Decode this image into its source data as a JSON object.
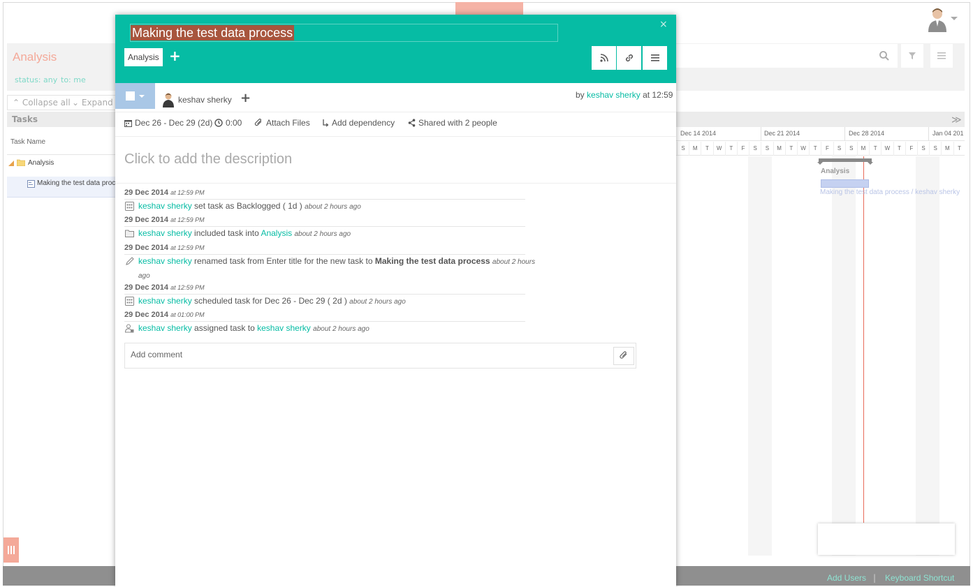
{
  "project": {
    "title": "Analysis",
    "filters": [
      "status: any",
      "to: me"
    ],
    "collapse_all": "Collapse all",
    "expand_all": "Expand a"
  },
  "task_panel": {
    "header": "Tasks",
    "column": "Task Name",
    "rows": [
      {
        "label": "Analysis",
        "icon": "folder-icon"
      },
      {
        "label": "Making the test data proce",
        "icon": "task-icon"
      }
    ]
  },
  "gantt": {
    "weeks": [
      "Dec 14 2014",
      "Dec 21 2014",
      "Dec 28 2014",
      "Jan 04 201"
    ],
    "days": [
      "S",
      "M",
      "T",
      "W",
      "T",
      "F",
      "S",
      "S",
      "M",
      "T",
      "W",
      "T",
      "F",
      "S",
      "S",
      "M",
      "T",
      "W",
      "T",
      "F",
      "S",
      "S",
      "M",
      "T"
    ],
    "group_label": "Analysis",
    "task_label": "Making the test data process / keshav sherky"
  },
  "footer": {
    "add_users": "Add Users",
    "separator": "|",
    "shortcut": "Keyboard Shortcut"
  },
  "modal": {
    "title": "Making the test data process",
    "close": "×",
    "tag": "Analysis",
    "add_tag": "+",
    "assignee": "keshav sherky",
    "add_assignee": "+",
    "created_prefix": "by",
    "created_by": "keshav sherky",
    "created_at": "at 12:59",
    "dates": "Dec 26 - Dec 29 (2d)",
    "time": "0:00",
    "attach": "Attach Files",
    "dependency": "Add dependency",
    "shared": "Shared with 2 people",
    "description_placeholder": "Click to add the description",
    "comment_placeholder": "Add comment",
    "log": [
      {
        "date": "29 Dec 2014",
        "time": "at 12:59 PM",
        "icon": "calendar-icon",
        "user": "keshav sherky",
        "text": "set task as Backlogged ( 1d )",
        "ago": "about 2 hours ago"
      },
      {
        "date": "29 Dec 2014",
        "time": "at 12:59 PM",
        "icon": "folder-icon",
        "user": "keshav sherky",
        "text": "included task into",
        "link": "Analysis",
        "ago": "about 2 hours ago"
      },
      {
        "date": "29 Dec 2014",
        "time": "at 12:59 PM",
        "icon": "pencil-icon",
        "user": "keshav sherky",
        "text": "renamed task from Enter title for the new task to",
        "bold": "Making the test data process",
        "ago": "about 2 hours",
        "ago2": "ago"
      },
      {
        "date": "29 Dec 2014",
        "time": "at 12:59 PM",
        "icon": "calendar-icon",
        "user": "keshav sherky",
        "text": "scheduled task for Dec 26 - Dec 29 ( 2d )",
        "ago": "about 2 hours ago"
      },
      {
        "date": "29 Dec 2014",
        "time": "at 01:00 PM",
        "icon": "assign-user-icon",
        "user": "keshav sherky",
        "text": "assigned task to",
        "link": "keshav sherky",
        "ago": "about 2 hours ago"
      }
    ]
  },
  "colors": {
    "teal": "#06bca4",
    "salmon": "#f4a999",
    "title_highlight": "#a7553d",
    "status_box": "#a9c7e6",
    "today_line": "#e86c5a"
  }
}
